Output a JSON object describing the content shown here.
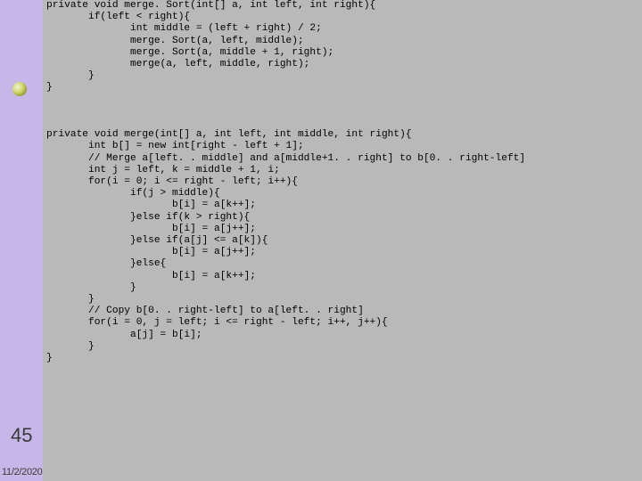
{
  "slide": {
    "page_number": "45",
    "date": "11/2/2020",
    "code": "private void merge. Sort(int[] a, int left, int right){\n       if(left < right){\n              int middle = (left + right) / 2;\n              merge. Sort(a, left, middle);\n              merge. Sort(a, middle + 1, right);\n              merge(a, left, middle, right);\n       }\n}\n\n\n\nprivate void merge(int[] a, int left, int middle, int right){\n       int b[] = new int[right - left + 1];\n       // Merge a[left. . middle] and a[middle+1. . right] to b[0. . right-left]\n       int j = left, k = middle + 1, i;\n       for(i = 0; i <= right - left; i++){\n              if(j > middle){\n                     b[i] = a[k++];\n              }else if(k > right){\n                     b[i] = a[j++];\n              }else if(a[j] <= a[k]){\n                     b[i] = a[j++];\n              }else{\n                     b[i] = a[k++];\n              }\n       }\n       // Copy b[0. . right-left] to a[left. . right]\n       for(i = 0, j = left; i <= right - left; i++, j++){\n              a[j] = b[i];\n       }\n}"
  }
}
